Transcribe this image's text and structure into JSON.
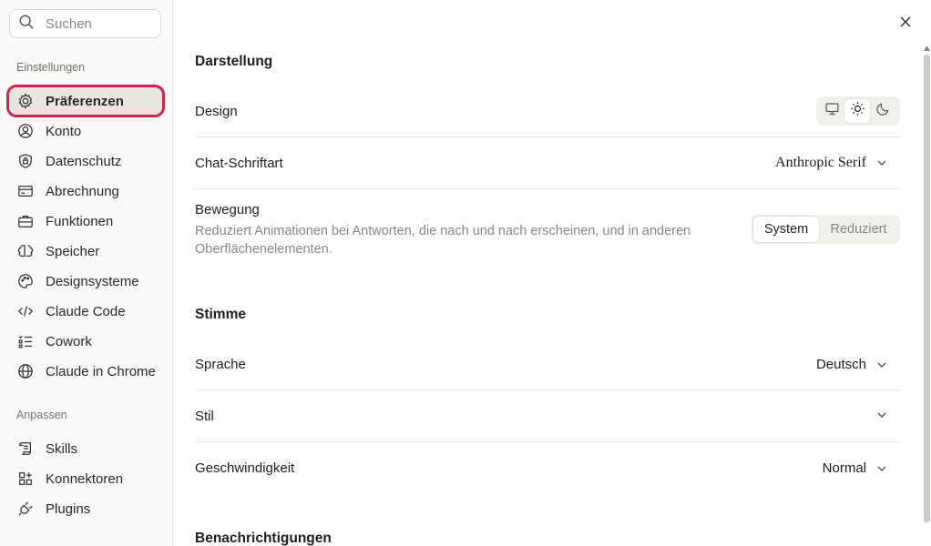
{
  "search": {
    "placeholder": "Suchen"
  },
  "sidebar": {
    "settings_label": "Einstellungen",
    "settings_items": [
      {
        "label": "Präferenzen",
        "icon": "gear-icon",
        "active": true
      },
      {
        "label": "Konto",
        "icon": "user-circle-icon"
      },
      {
        "label": "Datenschutz",
        "icon": "shield-lock-icon"
      },
      {
        "label": "Abrechnung",
        "icon": "credit-card-icon"
      },
      {
        "label": "Funktionen",
        "icon": "briefcase-icon"
      },
      {
        "label": "Speicher",
        "icon": "memory-icon"
      },
      {
        "label": "Designsysteme",
        "icon": "palette-icon"
      },
      {
        "label": "Claude Code",
        "icon": "code-icon"
      },
      {
        "label": "Cowork",
        "icon": "checklist-icon"
      },
      {
        "label": "Claude in Chrome",
        "icon": "globe-icon"
      }
    ],
    "customize_label": "Anpassen",
    "customize_items": [
      {
        "label": "Skills",
        "icon": "scroll-icon"
      },
      {
        "label": "Konnektoren",
        "icon": "grid-plus-icon"
      },
      {
        "label": "Plugins",
        "icon": "plug-icon"
      }
    ]
  },
  "main": {
    "appearance": {
      "title": "Darstellung",
      "design_label": "Design",
      "design_options": [
        "monitor-icon",
        "sun-icon",
        "moon-icon"
      ],
      "design_selected": "sun-icon",
      "font_label": "Chat-Schriftart",
      "font_value": "Anthropic Serif",
      "motion_label": "Bewegung",
      "motion_desc": "Reduziert Animationen bei Antworten, die nach und nach erscheinen, und in anderen Oberflächenelementen.",
      "motion_options": [
        "System",
        "Reduziert"
      ],
      "motion_selected": "System"
    },
    "voice": {
      "title": "Stimme",
      "language_label": "Sprache",
      "language_value": "Deutsch",
      "style_label": "Stil",
      "style_value": "",
      "speed_label": "Geschwindigkeit",
      "speed_value": "Normal"
    },
    "notifications": {
      "title": "Benachrichtigungen"
    }
  },
  "colors": {
    "accent_outline": "#d6204e",
    "sidebar_bg": "#fbfaf8"
  }
}
